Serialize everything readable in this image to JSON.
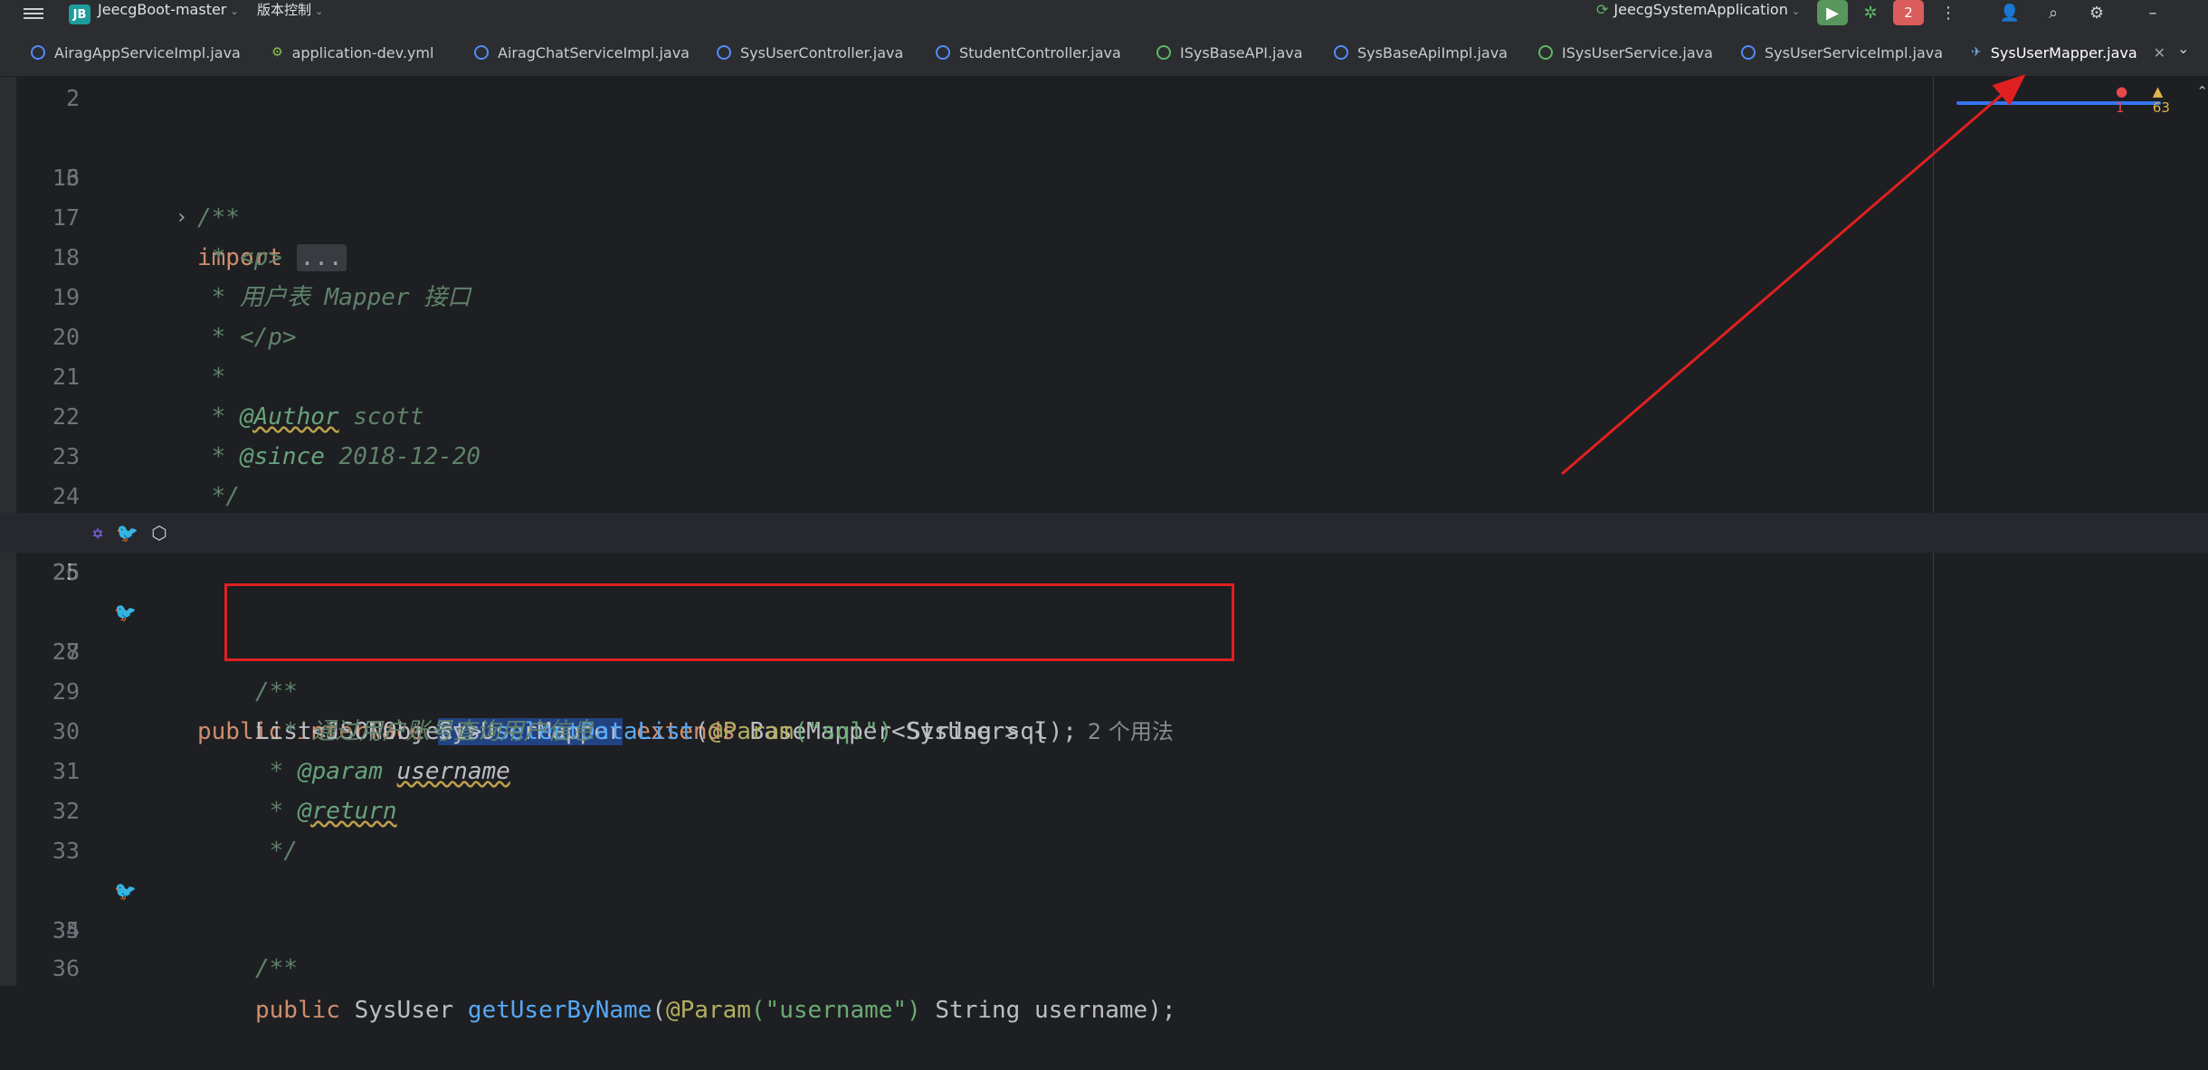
{
  "titlebar": {
    "project_badge": "JB",
    "project_name": "JeecgBoot-master",
    "vcs_menu": "版本控制",
    "run_config": "JeecgSystemApplication",
    "notifications_count": "2"
  },
  "tabs": [
    {
      "label": "AiragAppServiceImpl.java",
      "kind": "class"
    },
    {
      "label": "application-dev.yml",
      "kind": "yml"
    },
    {
      "label": "AiragChatServiceImpl.java",
      "kind": "class"
    },
    {
      "label": "SysUserController.java",
      "kind": "class"
    },
    {
      "label": "StudentController.java",
      "kind": "class"
    },
    {
      "label": "ISysBaseAPI.java",
      "kind": "interface"
    },
    {
      "label": "SysBaseApiImpl.java",
      "kind": "class"
    },
    {
      "label": "ISysUserService.java",
      "kind": "interface"
    },
    {
      "label": "SysUserServiceImpl.java",
      "kind": "class"
    },
    {
      "label": "SysUserMapper.java",
      "kind": "mapper",
      "active": true
    }
  ],
  "inspections": {
    "errors": "1",
    "warnings": "63"
  },
  "editor": {
    "line_numbers": [
      "2",
      "3",
      "16",
      "17",
      "18",
      "19",
      "20",
      "21",
      "22",
      "23",
      "24",
      "25",
      "26",
      "27",
      "28",
      "29",
      "30",
      "31",
      "32",
      "33",
      "34",
      "35",
      "36"
    ],
    "import_kw": "import",
    "import_fold": "...",
    "doc_open": "/**",
    "doc_p_open": " * <p>",
    "doc_desc": " * 用户表 Mapper 接口",
    "doc_p_close": " * </p>",
    "doc_star": " *",
    "doc_author_prefix": " * ",
    "doc_author_tag": "@Author",
    "doc_author_val": " scott",
    "doc_since_prefix": " * ",
    "doc_since_tag": "@since",
    "doc_since_val": " 2018-12-20",
    "doc_close": " */",
    "decl_public": "public ",
    "decl_interface": "interface ",
    "decl_name": "SysUserMapper",
    "decl_extends": " extends ",
    "decl_base": "BaseMapper<SysUser> {",
    "m1_type": "List<JSONObject> ",
    "m1_name": "selectDataList",
    "m1_open": "(",
    "m1_ann": "@Param",
    "m1_str": "(\"sql\")",
    "m1_rest": " String sql);",
    "m1_hint": "2 个用法",
    "doc2_open": "/**",
    "doc2_desc": "  * 通过用户账号查询用户信息",
    "doc2_param_prefix": " * ",
    "doc2_param_tag": "@param",
    "doc2_param_val": "username",
    "doc2_return_prefix": " * ",
    "doc2_return_tag": "@return",
    "doc2_close": " */",
    "m2_public": "public ",
    "m2_type": "SysUser ",
    "m2_name": "getUserByName",
    "m2_open": "(",
    "m2_ann": "@Param",
    "m2_str": "(\"username\")",
    "m2_rest": " String username);",
    "doc3_open": "/**"
  },
  "colors": {
    "annotation_box": "#e02020",
    "active_tab_underline": "#3574f0",
    "selection": "#214283"
  }
}
